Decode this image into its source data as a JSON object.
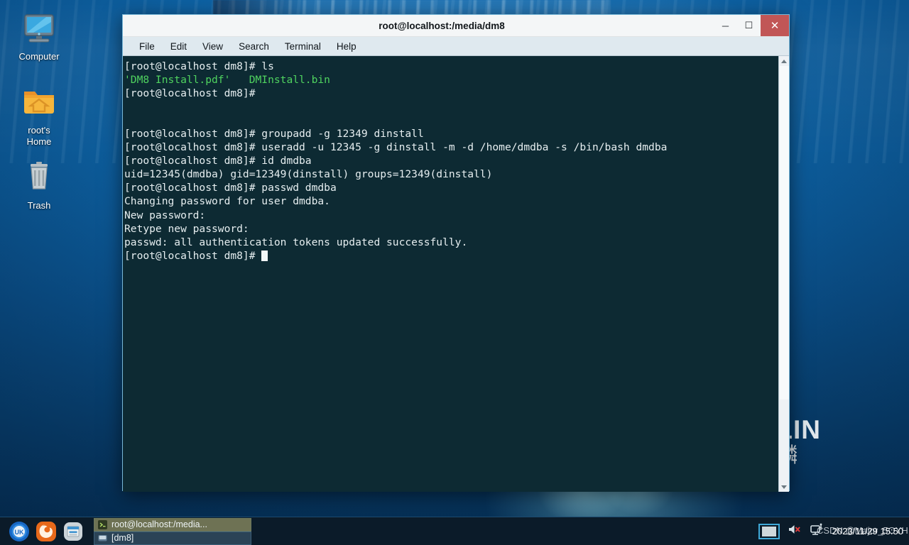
{
  "desktop": {
    "icons": [
      {
        "name": "computer",
        "label": "Computer",
        "icon": "monitor-icon"
      },
      {
        "name": "home",
        "label": "root's\nHome",
        "label_line1": "root's",
        "label_line2": "Home",
        "icon": "home-folder-icon"
      },
      {
        "name": "trash",
        "label": "Trash",
        "icon": "trash-icon"
      }
    ],
    "watermark": {
      "en": "KYLIN",
      "cn": "优麒麟"
    },
    "overlay_text": "CSDN @Major_5OYH"
  },
  "window": {
    "title": "root@localhost:/media/dm8",
    "controls": {
      "minimize": "─",
      "maximize": "☐",
      "close": "✕"
    },
    "menus": [
      "File",
      "Edit",
      "View",
      "Search",
      "Terminal",
      "Help"
    ]
  },
  "terminal": {
    "prompt": "[root@localhost dm8]#",
    "lines": [
      {
        "text": "[root@localhost dm8]# ls"
      },
      {
        "text": "'DM8 Install.pdf'   DMInstall.bin",
        "color": "green"
      },
      {
        "text": "[root@localhost dm8]#"
      },
      {
        "text": ""
      },
      {
        "text": ""
      },
      {
        "text": "[root@localhost dm8]# groupadd -g 12349 dinstall"
      },
      {
        "text": "[root@localhost dm8]# useradd -u 12345 -g dinstall -m -d /home/dmdba -s /bin/bash dmdba"
      },
      {
        "text": "[root@localhost dm8]# id dmdba"
      },
      {
        "text": "uid=12345(dmdba) gid=12349(dinstall) groups=12349(dinstall)"
      },
      {
        "text": "[root@localhost dm8]# passwd dmdba"
      },
      {
        "text": "Changing password for user dmdba."
      },
      {
        "text": "New password:"
      },
      {
        "text": "Retype new password:"
      },
      {
        "text": "passwd: all authentication tokens updated successfully."
      },
      {
        "text": "[root@localhost dm8]# ",
        "cursor": true
      }
    ],
    "colors": {
      "background": "#0d2a33",
      "foreground": "#e6eef0",
      "green": "#4fd35f"
    }
  },
  "taskbar": {
    "launchers": [
      {
        "name": "start-menu",
        "icon": "ukui-start-icon"
      },
      {
        "name": "firefox",
        "icon": "firefox-icon"
      },
      {
        "name": "file-manager",
        "icon": "file-manager-icon"
      }
    ],
    "tasks": [
      {
        "label": "root@localhost:/media...",
        "icon": "terminal-icon",
        "active": true
      },
      {
        "label": "[dm8]",
        "icon": "drive-icon",
        "active": false
      }
    ],
    "tray": {
      "workspace": "workspace-switcher",
      "volume": "volume-muted-icon",
      "network": "network-icon",
      "clock": "2023/11/29 15:50"
    }
  }
}
